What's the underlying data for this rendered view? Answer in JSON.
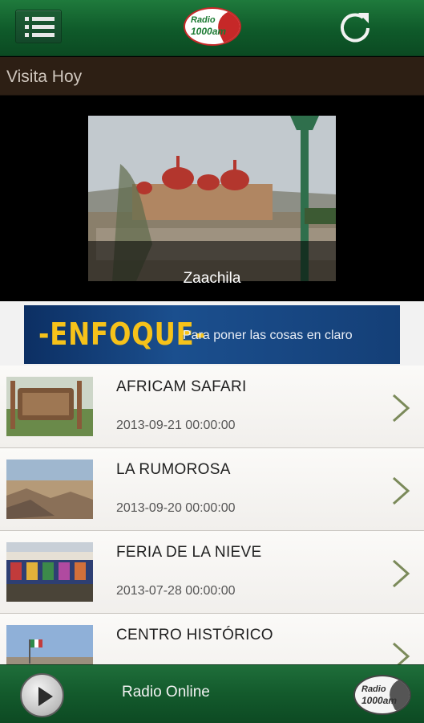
{
  "header": {
    "menu_icon": "list-menu-icon",
    "logo_line1": "Radio",
    "logo_line2": "1000am",
    "refresh_icon": "refresh-icon",
    "colors": {
      "bar": "#135a2c",
      "logo_red": "#c62828",
      "logo_green": "#1b7a32"
    }
  },
  "section": {
    "title": "Visita Hoy"
  },
  "featured": {
    "caption": "Zaachila"
  },
  "banner": {
    "title": "-ENFOQUE-",
    "tagline": "Para poner las cosas en claro"
  },
  "items": [
    {
      "title": "AFRICAM SAFARI",
      "date": "2013-09-21 00:00:00"
    },
    {
      "title": "LA RUMOROSA",
      "date": "2013-09-20 00:00:00"
    },
    {
      "title": "FERIA DE LA NIEVE",
      "date": "2013-07-28 00:00:00"
    },
    {
      "title": "CENTRO HISTÓRICO",
      "date": ""
    }
  ],
  "player": {
    "label": "Radio Online",
    "play_icon": "play-icon",
    "logo_line1": "Radio",
    "logo_line2": "1000am"
  }
}
